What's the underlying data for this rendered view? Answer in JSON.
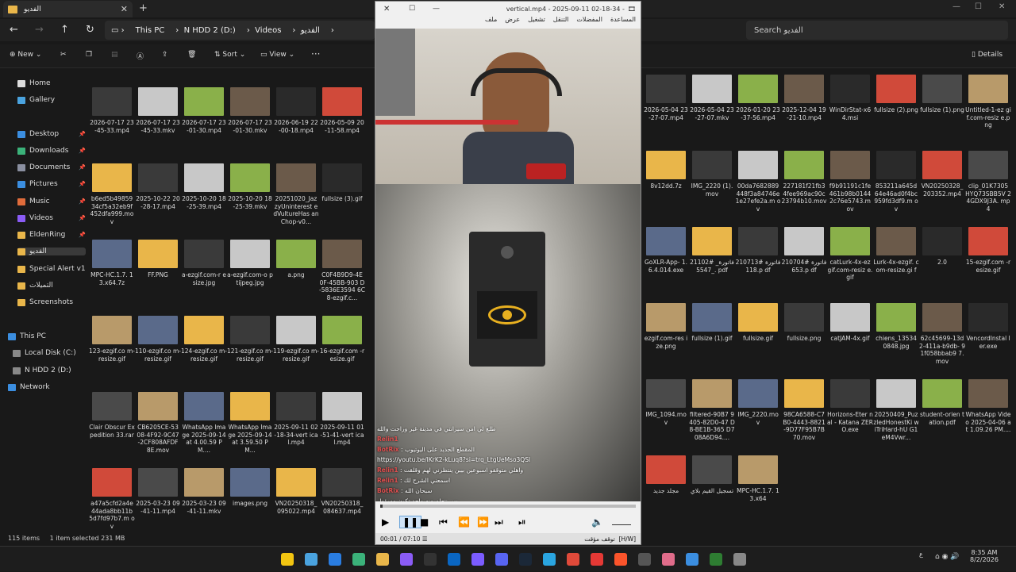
{
  "window": {
    "tab_title": "الفديو",
    "controls": [
      "—",
      "☐",
      "✕"
    ]
  },
  "nav": {
    "back": "←",
    "forward": "→",
    "up": "↑",
    "refresh": "↻"
  },
  "breadcrumb": [
    "This PC",
    "N HDD 2 (D:)",
    "Videos",
    "الفديو"
  ],
  "search": {
    "placeholder": "Search الفديو"
  },
  "toolbar": {
    "new": "New",
    "sort": "Sort",
    "view": "View",
    "more": "···",
    "details": "Details"
  },
  "sidebar": {
    "items": [
      {
        "label": "Home",
        "color": "#ddd"
      },
      {
        "label": "Gallery",
        "color": "#4aa3df"
      },
      {
        "label": "Desktop",
        "color": "#3b8ee0",
        "pin": true
      },
      {
        "label": "Downloads",
        "color": "#3bb27a",
        "pin": true
      },
      {
        "label": "Documents",
        "color": "#8a8fa0",
        "pin": true
      },
      {
        "label": "Pictures",
        "color": "#3b8ee0",
        "pin": true
      },
      {
        "label": "Music",
        "color": "#e06c3b",
        "pin": true
      },
      {
        "label": "Videos",
        "color": "#8b5cf6",
        "pin": true
      },
      {
        "label": "EldenRing",
        "color": "#e9b64a",
        "pin": true
      },
      {
        "label": "الفديو",
        "color": "#e9b64a",
        "selected": true
      },
      {
        "label": "Special Alert v1",
        "color": "#e9b64a"
      },
      {
        "label": "التميلات",
        "color": "#e9b64a"
      },
      {
        "label": "Screenshots",
        "color": "#e9b64a"
      },
      {
        "label": "This PC",
        "color": "#3b8ee0"
      },
      {
        "label": "Local Disk (C:)",
        "color": "#888"
      },
      {
        "label": "N HDD 2 (D:)",
        "color": "#888"
      },
      {
        "label": "Network",
        "color": "#3b8ee0"
      }
    ]
  },
  "files_left": [
    [
      "2026-07-17 23-45-33.mp4",
      "2026-07-17 23-45-33.mkv",
      "2026-07-17 23-01-30.mp4",
      "2026-07-17 23-01-30.mkv",
      "2026-06-19 22-00-18.mp4",
      "2026-05-09 20-11-58.mp4"
    ],
    [
      "b6ed5b49859 34cf5a32eb9f 452dfa999.mov",
      "2025-10-22 20-28-17.mp4",
      "2025-10-20 18-25-39.mp4",
      "2025-10-20 18-25-39.mkv",
      "20251020_Jaz zyUninterest edVultureHas anChop-v0...",
      "fullsize (3).gif"
    ],
    [
      "MPC-HC.1.7. 13.x64.7z",
      "FF.PNG",
      "a-ezgif.com-r esize.jpg",
      "a-ezgif.com-o ptijpeg.jpg",
      "a.png",
      "C0F4B9D9-4E 0F-45BB-903 D-5836E3594 6C8-ezgif.c..."
    ],
    [
      "123-ezgif.co m-resize.gif",
      "110-ezgif.co m-resize.gif",
      "124-ezgif.co m-resize.gif",
      "121-ezgif.co m-resize.gif",
      "119-ezgif.co m-resize.gif",
      "16-ezgif.com -resize.gif"
    ],
    [
      "Clair Obscur Expedition 33.rar",
      "CB6205CE-53 08-4F92-9C47 -2CF808AFDF 8E.mov",
      "WhatsApp Image 2025-09-14 at 4.00.59 PM....",
      "WhatsApp Image 2025-09-14 at 3.59.50 PM...",
      "2025-09-11 02-18-34-vert ical.mp4",
      "2025-09-11 01-51-41-vert ical.mp4"
    ],
    [
      "a47a5cfd2a4e 44ada8bb11b 5d7fd97b7.m ov",
      "2025-03-23 09-41-11.mp4",
      "2025-03-23 09-41-11.mkv",
      "images.png",
      "VN20250318_ 095022.mp4",
      "VN20250318_ 084637.mp4"
    ]
  ],
  "files_right": [
    [
      "2026-05-04 23-27-07.mp4",
      "2026-05-04 23-27-07.mkv",
      "2026-01-20 23-37-56.mp4",
      "2025-12-04 19-21-10.mp4",
      "WinDirStat-x6 4.msi",
      "fullsize (2).png",
      "fullsize (1).png",
      "Untitled-1-ez gif.com-resiz e.png"
    ],
    [
      "8v12dd.7z",
      "IMG_2220 (1).mov",
      "00da7682889 448f3a84746e 1e27efe2a.m ov",
      "227181f21fb3 4fee969ac90c 23794b10.mov",
      "f9b91191c1fe 461b98b0144 2c76e5743.m ov",
      "853211a645d 64e46ad0f4bc 959fd3df9.m ov",
      "VN20250328_ 203352.mp4",
      "clip_01K7305 HYQ73SBB5V 24GDX9J3A. mp4"
    ],
    [
      "GoXLR-App- 1.6.4.014.exe",
      "فاتورة_ #211025547_. pdf",
      "فاتورة #210713118.p df",
      "فاتورة #210704653.p df",
      "catLurk-4x-ez gif.com-resiz e.gif",
      "Lurk-4x-ezgif. com-resize.gi f",
      "2.0",
      "15-ezgif.com -resize.gif"
    ],
    [
      "ezgif.com-res ize.png",
      "fullsize (1).gif",
      "fullsize.gif",
      "fullsize.png",
      "catJAM-4x.gif",
      "chiens_13534 0848.jpg",
      "62c45699-13d 2-411a-b9db- 91f058bbab9 7.mov",
      "VencordInstal ler.exe"
    ],
    [
      "IMG_1094.mo v",
      "filtered-90B7 9405-82D0-47 D8-BE1B-365 D708A6D94....",
      "IMG_2220.mo v",
      "98CA6588-C7 B0-4443-8821 -9D77F95B7B 70.mov",
      "Horizons-Eter nal - Katana ZERO.exe",
      "20250409_Puz zledHonestKi wiTriHard-hU G1eM4Vwr...",
      "student-orien tation.pdf",
      "WhatsApp Video 2025-04-06 at 1.09.26 PM...."
    ],
    [
      "مجلد جديد",
      "تسجيل القيم بلاي",
      "MPC-HC.1.7. 13.x64"
    ]
  ],
  "status": {
    "items": "115 items",
    "selected": "1 item selected  231 MB"
  },
  "player": {
    "title": "vertical.mp4 - 2025-09-11 02-18-34 -",
    "menu": [
      "ملف",
      "عرض",
      "تشغيل",
      "التنقل",
      "المفضلات",
      "المساعدة"
    ],
    "state": "توقف مؤقت",
    "keys": "[H/W]",
    "time": "00:01 / 07:10",
    "chat": [
      {
        "user": "",
        "text": "طلع لي امن سيرانتي في مدينة غير وراحت والله"
      },
      {
        "user": "Relin1",
        "text": ""
      },
      {
        "user": "BotRix",
        "text": ": المقطع الجديد على اليوتيوب"
      },
      {
        "user": "",
        "text": "https://youtu.be/IKrK2-kLuq8?si=trq_LtgUeMso3QSl"
      },
      {
        "user": "Relin1",
        "text": ": واهلي متوقفو اسبوعين بيين ينتظرني لهم وقلقت"
      },
      {
        "user": "Relin1",
        "text": ": اسمعني الشرح لك"
      },
      {
        "user": "BotRix",
        "text": ": سبحان الله"
      },
      {
        "user": "",
        "text": "بس نتعلم منه واجد تكون مسؤول"
      }
    ]
  },
  "taskbar": {
    "time": "8:35 AM",
    "date": "8/2/2026",
    "lang": "ع"
  }
}
